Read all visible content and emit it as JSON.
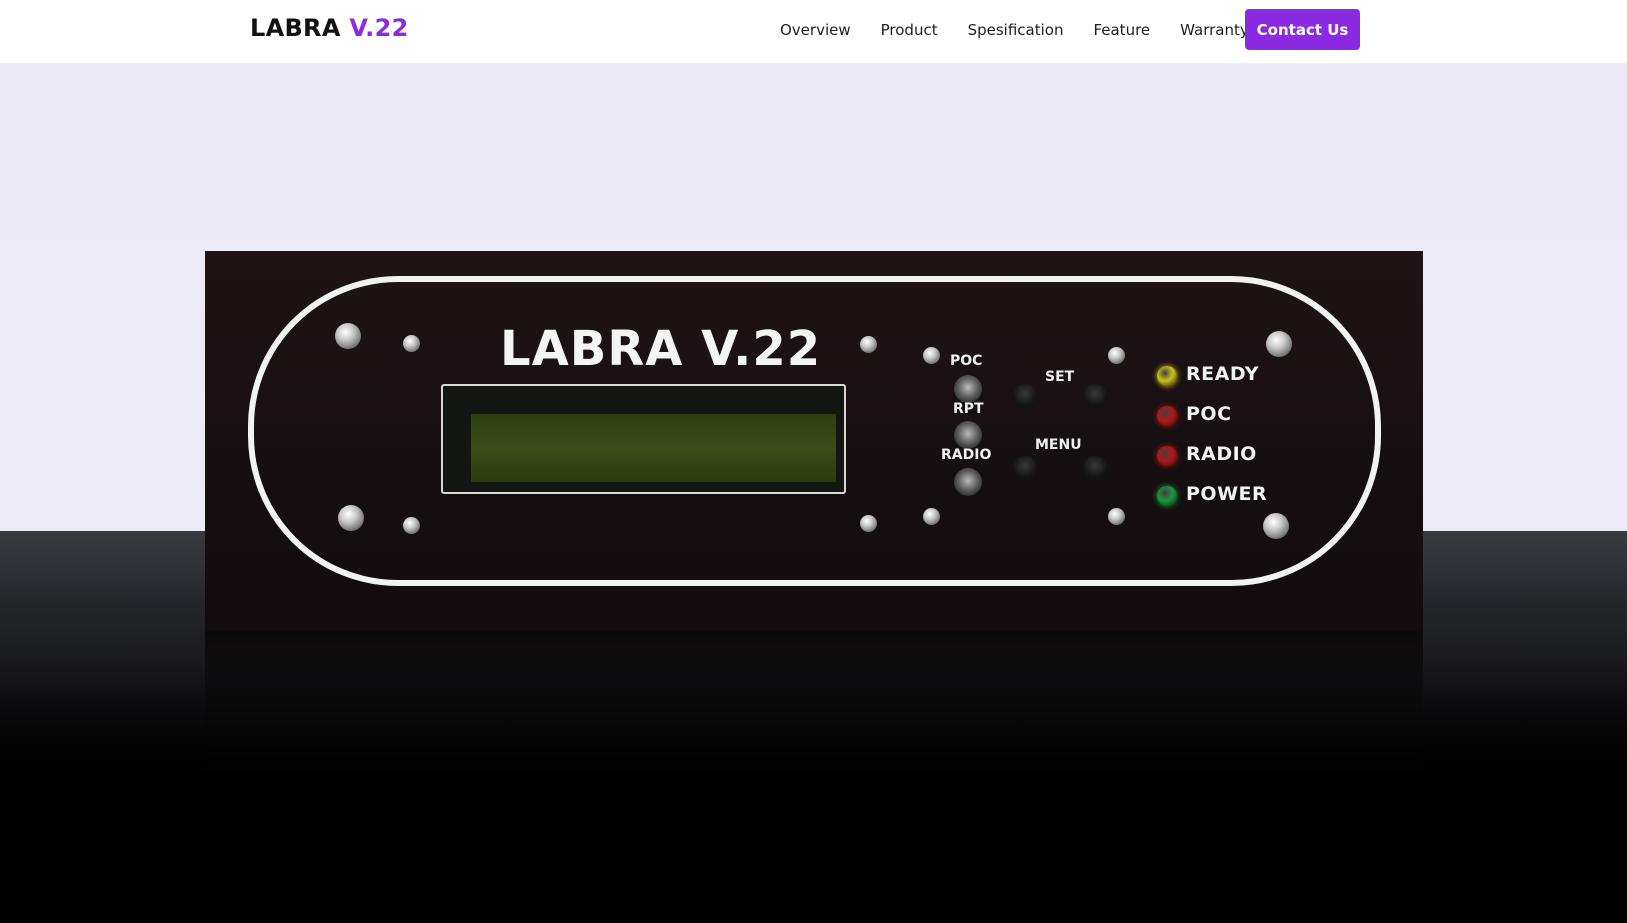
{
  "brand": {
    "main": "LABRA",
    "accent": "V.22",
    "accent_color": "#8a2be2"
  },
  "nav": {
    "links": [
      "Overview",
      "Product",
      "Spesification",
      "Feature",
      "Warranty"
    ],
    "cta_label": "Contact Us"
  },
  "hero": {
    "device": {
      "logo": "LABRA V.22",
      "switch_labels": [
        "POC",
        "RPT",
        "RADIO"
      ],
      "button_labels": [
        "SET",
        "MENU"
      ],
      "leds": [
        {
          "label": "READY",
          "color": "#c9c21a"
        },
        {
          "label": "POC",
          "color": "#b51616"
        },
        {
          "label": "RADIO",
          "color": "#b51616"
        },
        {
          "label": "POWER",
          "color": "#1a9a3a"
        }
      ]
    }
  }
}
